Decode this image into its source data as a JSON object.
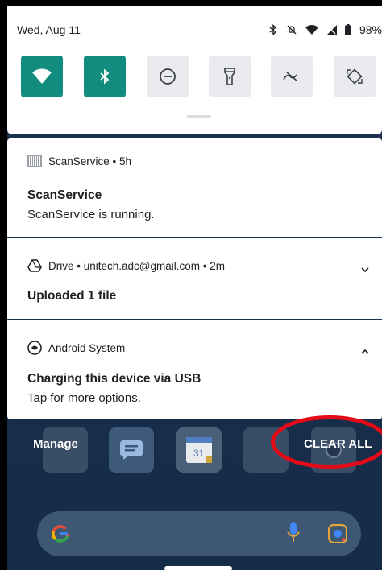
{
  "status_bar": {
    "date": "Wed, Aug 11",
    "battery": "98%",
    "icons": [
      "bluetooth-icon",
      "mute-icon",
      "wifi-icon",
      "signal-icon",
      "battery-icon"
    ]
  },
  "quick_settings": {
    "tiles": [
      {
        "name": "wifi",
        "state": "on"
      },
      {
        "name": "bluetooth",
        "state": "on"
      },
      {
        "name": "do-not-disturb",
        "state": "off"
      },
      {
        "name": "flashlight",
        "state": "off"
      },
      {
        "name": "mobile-data",
        "state": "off"
      },
      {
        "name": "auto-rotate",
        "state": "off"
      }
    ],
    "accent": "#128c7e"
  },
  "notifications": [
    {
      "app": "ScanService • 5h",
      "title": "ScanService",
      "text": "ScanService is running."
    },
    {
      "app": "Drive • unitech.adc@gmail.com • 2m",
      "title": "Uploaded 1 file"
    },
    {
      "app": "Android System",
      "title": "Charging this device via USB",
      "text": "Tap for more options."
    }
  ],
  "actions": {
    "manage": "Manage",
    "clear_all": "CLEAR ALL"
  },
  "annotation": {
    "color": "#e30b17",
    "shape": "ellipse around CLEAR ALL"
  }
}
